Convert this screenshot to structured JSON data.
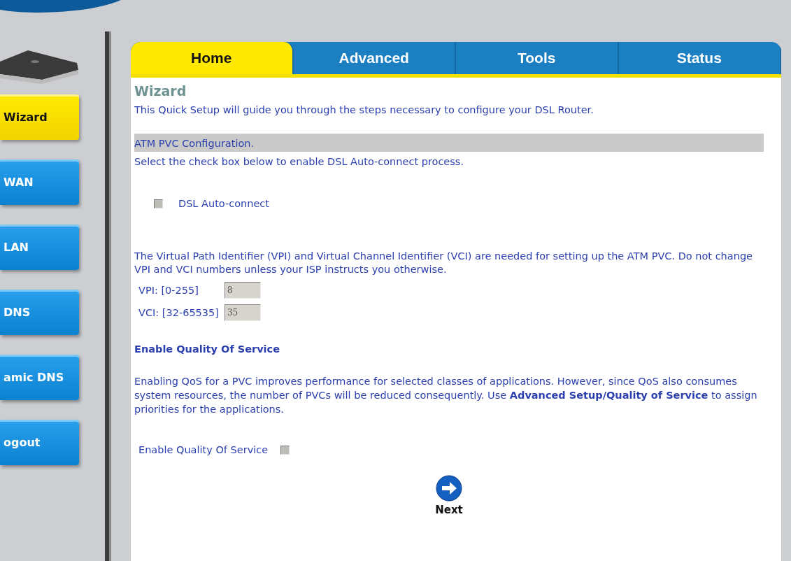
{
  "sidebar": {
    "items": [
      {
        "label": "Wizard",
        "selected": true
      },
      {
        "label": "WAN",
        "selected": false
      },
      {
        "label": "LAN",
        "selected": false
      },
      {
        "label": "DNS",
        "selected": false
      },
      {
        "label": "amic DNS",
        "selected": false
      },
      {
        "label": "ogout",
        "selected": false
      }
    ]
  },
  "tabs": [
    {
      "label": "Home",
      "selected": true
    },
    {
      "label": "Advanced",
      "selected": false
    },
    {
      "label": "Tools",
      "selected": false
    },
    {
      "label": "Status",
      "selected": false
    }
  ],
  "section_title": "Wizard",
  "intro": "This Quick Setup will guide you through the steps necessary to configure your DSL Router.",
  "section_bar": "ATM PVC Configuration.",
  "instruction": "Select the check box below to enable DSL Auto-connect process.",
  "auto_connect": {
    "label": "DSL Auto-connect",
    "checked": false,
    "disabled": true
  },
  "vpi_vci_note": "The Virtual Path Identifier (VPI) and Virtual Channel Identifier (VCI) are needed for setting up the ATM PVC. Do not change VPI and VCI numbers unless your ISP instructs you otherwise.",
  "fields": [
    {
      "label": "VPI: [0-255]",
      "value": "8",
      "disabled": true
    },
    {
      "label": "VCI: [32-65535]",
      "value": "35",
      "disabled": true
    }
  ],
  "qos_heading": "Enable Quality Of Service",
  "qos_note": "Enabling QoS for a PVC improves performance for selected classes of applications. However, since QoS also consumes system resources, the number of PVCs will be reduced consequently. Use **Advanced Setup/Quality of Service** to assign priorities for the applications.",
  "qos_toggle": {
    "label": "Enable Quality Of Service",
    "checked": false,
    "disabled": true
  },
  "next_button": {
    "label": "Next"
  }
}
